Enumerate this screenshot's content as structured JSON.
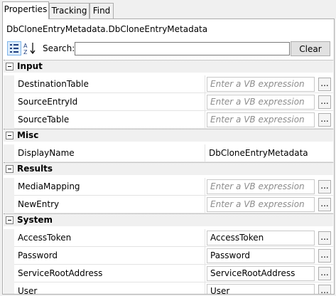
{
  "tabs": [
    "Properties",
    "Tracking",
    "Find"
  ],
  "type_name": "DbCloneEntryMetadata.DbCloneEntryMetadata",
  "toolbar": {
    "search_label": "Search:",
    "search_value": "",
    "clear_label": "Clear"
  },
  "ellipsis": "...",
  "categories": [
    {
      "name": "Input",
      "props": [
        {
          "name": "DestinationTable",
          "value": "Enter a VB expression",
          "placeholder": true,
          "button": true
        },
        {
          "name": "SourceEntryId",
          "value": "Enter a VB expression",
          "placeholder": true,
          "button": true
        },
        {
          "name": "SourceTable",
          "value": "Enter a VB expression",
          "placeholder": true,
          "button": true
        }
      ]
    },
    {
      "name": "Misc",
      "props": [
        {
          "name": "DisplayName",
          "value": "DbCloneEntryMetadata",
          "placeholder": false,
          "button": false
        }
      ]
    },
    {
      "name": "Results",
      "props": [
        {
          "name": "MediaMapping",
          "value": "Enter a VB expression",
          "placeholder": true,
          "button": true
        },
        {
          "name": "NewEntry",
          "value": "Enter a VB expression",
          "placeholder": true,
          "button": true
        }
      ]
    },
    {
      "name": "System",
      "props": [
        {
          "name": "AccessToken",
          "value": "AccessToken",
          "placeholder": false,
          "button": true
        },
        {
          "name": "Password",
          "value": "Password",
          "placeholder": false,
          "button": true
        },
        {
          "name": "ServiceRootAddress",
          "value": "ServiceRootAddress",
          "placeholder": false,
          "button": true
        },
        {
          "name": "User",
          "value": "User",
          "placeholder": false,
          "button": true
        }
      ]
    }
  ]
}
